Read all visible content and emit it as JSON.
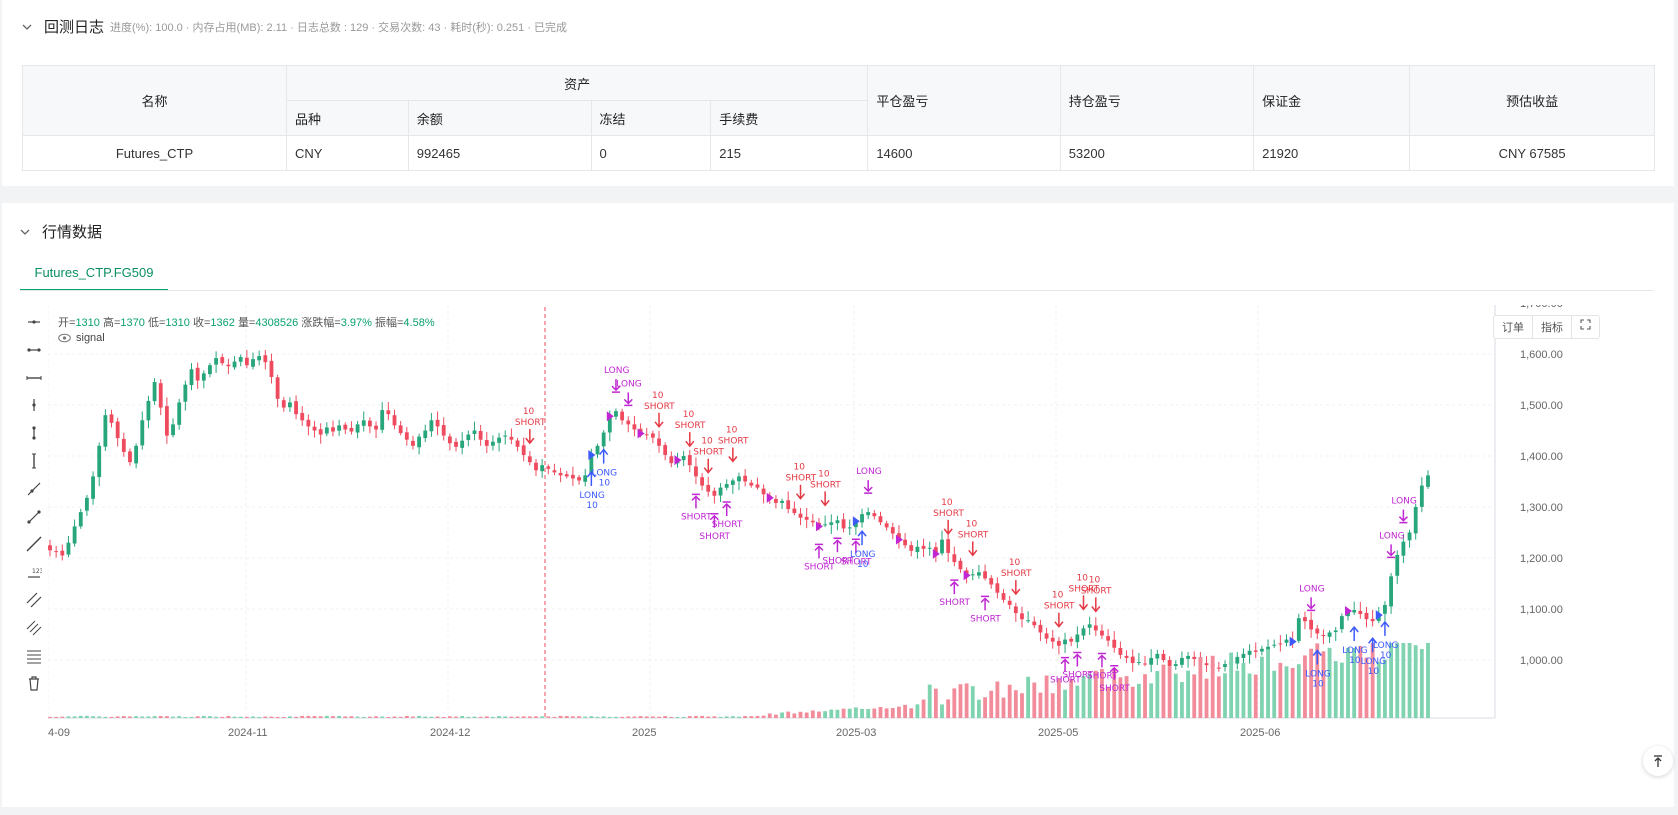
{
  "backtest_log": {
    "title": "回测日志",
    "meta": "进度(%): 100.0 · 内存占用(MB): 2.11 · 日志总数 : 129 · 交易次数: 43 · 耗时(秒): 0.251 · 已完成"
  },
  "assets_table": {
    "headers": {
      "name": "名称",
      "assets": "资产",
      "variety": "品种",
      "balance": "余额",
      "frozen": "冻结",
      "fee": "手续费",
      "close_pnl": "平仓盈亏",
      "hold_pnl": "持仓盈亏",
      "margin": "保证金",
      "est_profit": "预估收益"
    },
    "row": {
      "name": "Futures_CTP",
      "variety": "CNY",
      "balance": "992465",
      "frozen": "0",
      "fee": "215",
      "close_pnl": "14600",
      "hold_pnl": "53200",
      "margin": "21920",
      "est_profit": "CNY 67585"
    }
  },
  "market": {
    "title": "行情数据",
    "tab": "Futures_CTP.FG509",
    "ohlc": {
      "open_label": "开=",
      "open": "1310",
      "high_label": "高=",
      "high": "1370",
      "low_label": "低=",
      "low": "1310",
      "close_label": "收=",
      "close": "1362",
      "vol_label": "量=",
      "vol": "4308526",
      "chg_label": "涨跌幅=",
      "chg": "3.97%",
      "amp_label": "振幅=",
      "amp": "4.58%"
    },
    "signal_label": "signal",
    "buttons": {
      "order": "订单",
      "indicator": "指标"
    }
  },
  "chart_data": {
    "type": "candlestick",
    "y_axis_ticks": [
      "1,700.00",
      "1,600.00",
      "1,500.00",
      "1,400.00",
      "1,300.00",
      "1,200.00",
      "1,100.00",
      "1,000.00"
    ],
    "x_axis_ticks": [
      "4-09",
      "2024-11",
      "2024-12",
      "2025",
      "2025-03",
      "2025-05",
      "2025-06"
    ],
    "ylim": [
      890,
      1730
    ],
    "colors": {
      "up": "#26a67a",
      "down": "#ef4b5f",
      "vol_up": "#7fd3b1",
      "vol_down": "#f28c9b",
      "long": "#3d5afe",
      "short": "#e53945",
      "exit": "#c026d3"
    },
    "closes": [
      1215,
      1212,
      1205,
      1230,
      1262,
      1290,
      1318,
      1360,
      1420,
      1480,
      1465,
      1435,
      1408,
      1388,
      1420,
      1470,
      1508,
      1545,
      1495,
      1440,
      1462,
      1505,
      1540,
      1570,
      1548,
      1562,
      1578,
      1592,
      1582,
      1576,
      1585,
      1594,
      1578,
      1590,
      1596,
      1584,
      1555,
      1512,
      1495,
      1505,
      1482,
      1470,
      1458,
      1450,
      1442,
      1456,
      1448,
      1460,
      1452,
      1448,
      1462,
      1470,
      1458,
      1452,
      1490,
      1482,
      1460,
      1445,
      1432,
      1420,
      1438,
      1450,
      1470,
      1458,
      1440,
      1425,
      1418,
      1430,
      1442,
      1450,
      1432,
      1420,
      1428,
      1436,
      1440,
      1432,
      1418,
      1402,
      1388,
      1372,
      1382,
      1375,
      1368,
      1362,
      1360,
      1356,
      1352,
      1362,
      1402,
      1420,
      1446,
      1478,
      1488,
      1470,
      1462,
      1452,
      1444,
      1442,
      1436,
      1420,
      1402,
      1386,
      1392,
      1400,
      1382,
      1360,
      1342,
      1330,
      1322,
      1338,
      1345,
      1352,
      1360,
      1350,
      1342,
      1338,
      1325,
      1318,
      1308,
      1312,
      1296,
      1288,
      1279,
      1275,
      1270,
      1262,
      1266,
      1270,
      1274,
      1258,
      1260,
      1272,
      1286,
      1290,
      1282,
      1270,
      1260,
      1248,
      1236,
      1225,
      1214,
      1222,
      1218,
      1220,
      1208,
      1236,
      1210,
      1192,
      1178,
      1166,
      1168,
      1172,
      1160,
      1148,
      1132,
      1118,
      1108,
      1092,
      1080,
      1078,
      1068,
      1054,
      1042,
      1036,
      1028,
      1040,
      1036,
      1050,
      1062,
      1070,
      1058,
      1048,
      1038,
      1024,
      1010,
      1004,
      994,
      996,
      992,
      1004,
      1012,
      1000,
      988,
      992,
      1004,
      1008,
      1002,
      996,
      990,
      986,
      984,
      992,
      996,
      1006,
      1012,
      1018,
      1016,
      1022,
      1026,
      1030,
      1032,
      1040,
      1036,
      1082,
      1076,
      1060,
      1052,
      1048,
      1054,
      1058,
      1086,
      1096,
      1098,
      1090,
      1080,
      1076,
      1088,
      1108,
      1164,
      1206,
      1232,
      1250,
      1300,
      1342,
      1362
    ]
  }
}
